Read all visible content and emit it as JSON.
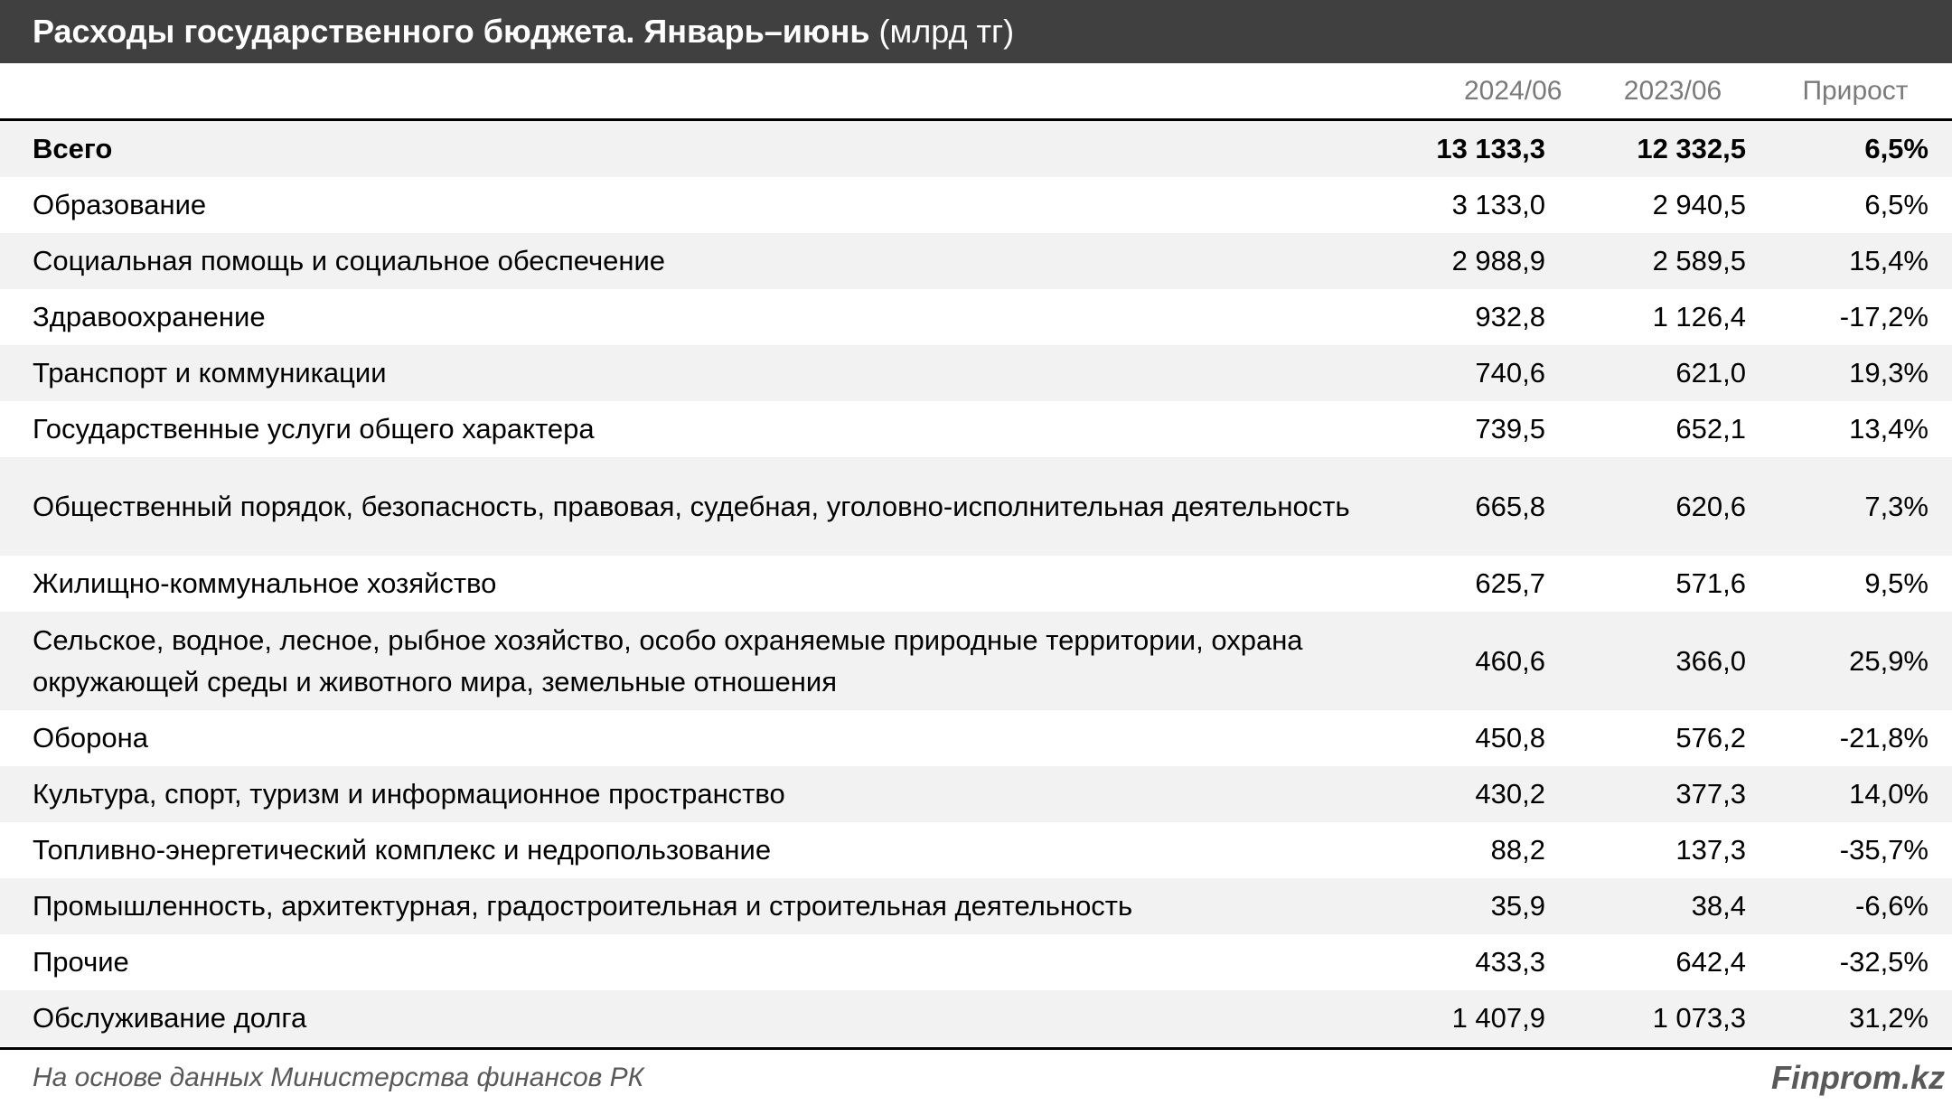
{
  "title": {
    "main": "Расходы государственного бюджета. Январь–июнь",
    "unit": "(млрд тг)"
  },
  "chart_data": {
    "type": "table",
    "columns": [
      "2024/06",
      "2023/06",
      "Прирост"
    ],
    "rows": [
      {
        "label": "Всего",
        "v2024": "13 133,3",
        "v2023": "12 332,5",
        "growth": "6,5%"
      },
      {
        "label": "Образование",
        "v2024": "3 133,0",
        "v2023": "2 940,5",
        "growth": "6,5%"
      },
      {
        "label": "Социальная помощь и социальное обеспечение",
        "v2024": "2 988,9",
        "v2023": "2 589,5",
        "growth": "15,4%"
      },
      {
        "label": "Здравоохранение",
        "v2024": "932,8",
        "v2023": "1 126,4",
        "growth": "-17,2%"
      },
      {
        "label": "Транспорт и коммуникации",
        "v2024": "740,6",
        "v2023": "621,0",
        "growth": "19,3%"
      },
      {
        "label": "Государственные услуги общего характера",
        "v2024": "739,5",
        "v2023": "652,1",
        "growth": "13,4%"
      },
      {
        "label": "Общественный порядок, безопасность, правовая, судебная, уголовно-исполнительная деятельность",
        "v2024": "665,8",
        "v2023": "620,6",
        "growth": "7,3%"
      },
      {
        "label": "Жилищно-коммунальное хозяйство",
        "v2024": "625,7",
        "v2023": "571,6",
        "growth": "9,5%"
      },
      {
        "label": "Сельское, водное, лесное, рыбное хозяйство, особо охраняемые природные территории, охрана окружающей среды и животного мира, земельные отношения",
        "v2024": "460,6",
        "v2023": "366,0",
        "growth": "25,9%"
      },
      {
        "label": "Оборона",
        "v2024": "450,8",
        "v2023": "576,2",
        "growth": "-21,8%"
      },
      {
        "label": "Культура, спорт, туризм и информационное пространство",
        "v2024": "430,2",
        "v2023": "377,3",
        "growth": "14,0%"
      },
      {
        "label": "Топливно-энергетический комплекс и недропользование",
        "v2024": "88,2",
        "v2023": "137,3",
        "growth": "-35,7%"
      },
      {
        "label": "Промышленность, архитектурная, градостроительная и строительная деятельность",
        "v2024": "35,9",
        "v2023": "38,4",
        "growth": "-6,6%"
      },
      {
        "label": "Прочие",
        "v2024": "433,3",
        "v2023": "642,4",
        "growth": "-32,5%"
      },
      {
        "label": "Обслуживание долга",
        "v2024": "1 407,9",
        "v2023": "1 073,3",
        "growth": "31,2%"
      }
    ]
  },
  "footer": {
    "source": "На основе данных Министерства финансов РК",
    "brand": "Finprom.kz"
  }
}
